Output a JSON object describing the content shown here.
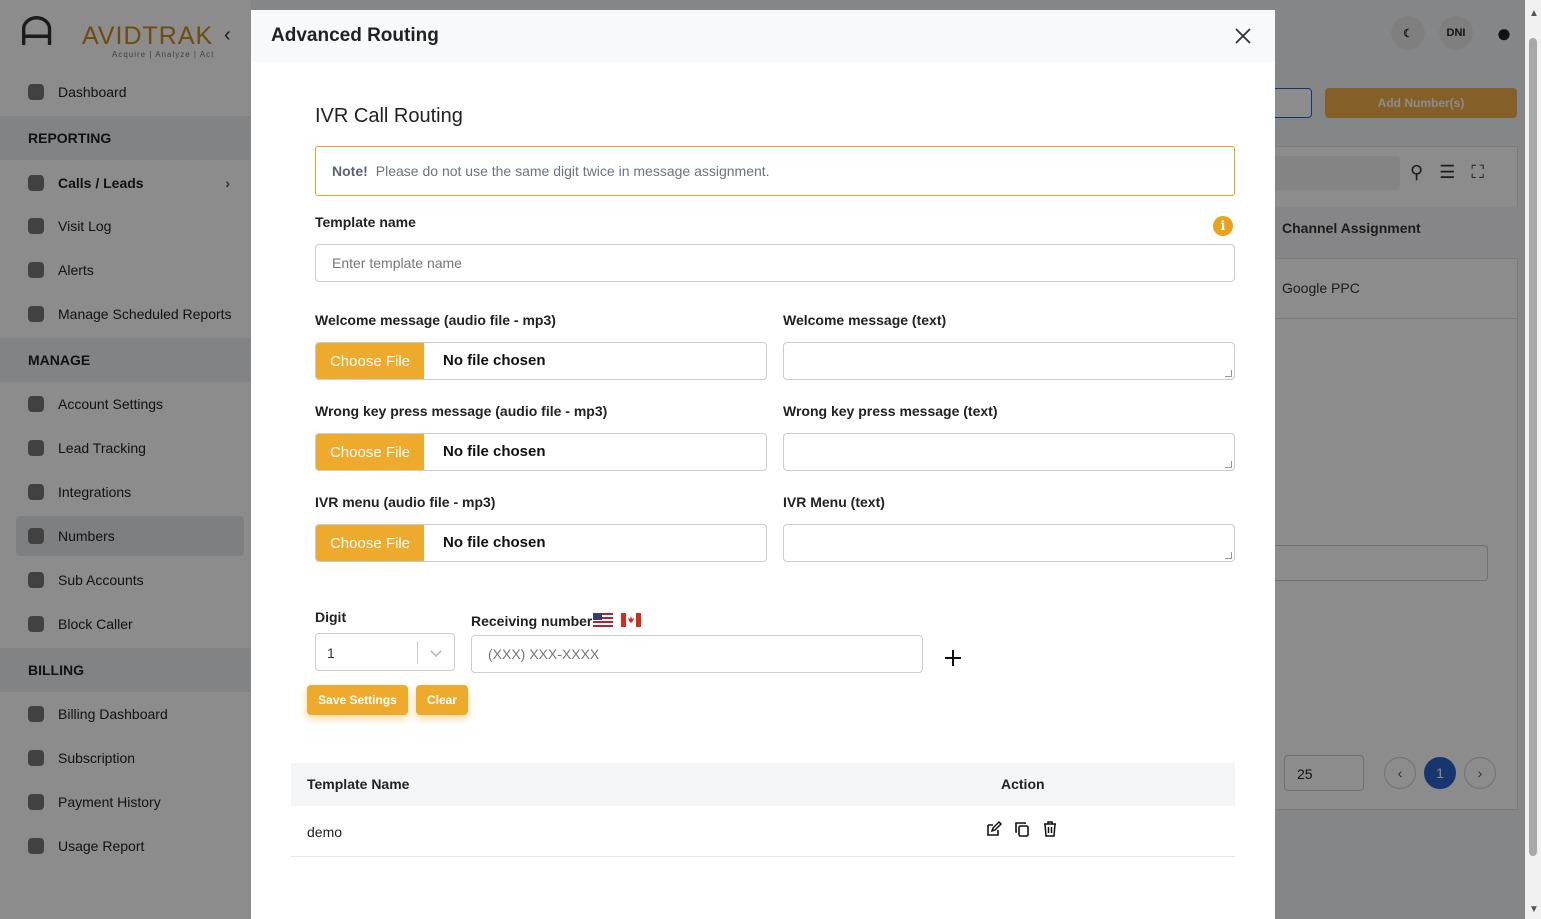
{
  "background": {
    "logo": {
      "brand": "AVIDTRAK",
      "tagline": "Acquire | Analyze | Act"
    },
    "sidebar": {
      "items": [
        {
          "label": "Dashboard",
          "icon": "dashboard-icon"
        },
        {
          "section": "REPORTING"
        },
        {
          "label": "Calls / Leads",
          "icon": "phone-icon"
        },
        {
          "label": "Visit Log",
          "icon": "globe-icon"
        },
        {
          "label": "Alerts",
          "icon": "chat-icon"
        },
        {
          "label": "Manage Scheduled Reports",
          "icon": "calendar-icon"
        },
        {
          "section": "MANAGE"
        },
        {
          "label": "Account Settings",
          "icon": "gear-icon"
        },
        {
          "label": "Lead Tracking",
          "icon": "pie-icon"
        },
        {
          "label": "Integrations",
          "icon": "integrations-icon"
        },
        {
          "label": "Numbers",
          "icon": "hash-icon"
        },
        {
          "label": "Sub Accounts",
          "icon": "users-icon"
        },
        {
          "label": "Block Caller",
          "icon": "user-block-icon"
        },
        {
          "section": "BILLING"
        },
        {
          "label": "Billing Dashboard",
          "icon": "card-icon"
        },
        {
          "label": "Subscription",
          "icon": "subscription-icon"
        },
        {
          "label": "Payment History",
          "icon": "dollar-icon"
        },
        {
          "label": "Usage Report",
          "icon": "report-icon"
        }
      ]
    },
    "topbar": {
      "dni_label": "DNI"
    },
    "toolbar": {
      "add_numbers_label": "Add Number(s)"
    },
    "table": {
      "column_header": "Channel Assignment",
      "cell_value": "Google PPC"
    },
    "pager": {
      "page_size": "25",
      "current_page": "1"
    }
  },
  "modal": {
    "title": "Advanced Routing",
    "section_title": "IVR Call Routing",
    "note": {
      "label": "Note!",
      "text": "Please do not use the same digit twice in message assignment."
    },
    "template_name": {
      "label": "Template name",
      "placeholder": "Enter template name"
    },
    "welcome_audio": {
      "label": "Welcome message (audio file - mp3)",
      "button": "Choose File",
      "file_status": "No file chosen"
    },
    "welcome_text": {
      "label": "Welcome message (text)"
    },
    "wrong_key_audio": {
      "label": "Wrong key press message (audio file - mp3)",
      "button": "Choose File",
      "file_status": "No file chosen"
    },
    "wrong_key_text": {
      "label": "Wrong key press message (text)"
    },
    "ivr_audio": {
      "label": "IVR menu (audio file - mp3)",
      "button": "Choose File",
      "file_status": "No file chosen"
    },
    "ivr_text": {
      "label": "IVR Menu (text)"
    },
    "digit": {
      "label": "Digit",
      "value": "1"
    },
    "receiving_number": {
      "label": "Receiving number",
      "placeholder": "(XXX) XXX-XXXX"
    },
    "buttons": {
      "save": "Save Settings",
      "clear": "Clear"
    },
    "templates_table": {
      "headers": {
        "name": "Template Name",
        "action": "Action"
      },
      "rows": [
        {
          "name": "demo"
        }
      ]
    },
    "colors": {
      "accent": "#edaa2c",
      "note_border": "#e0a526"
    }
  }
}
